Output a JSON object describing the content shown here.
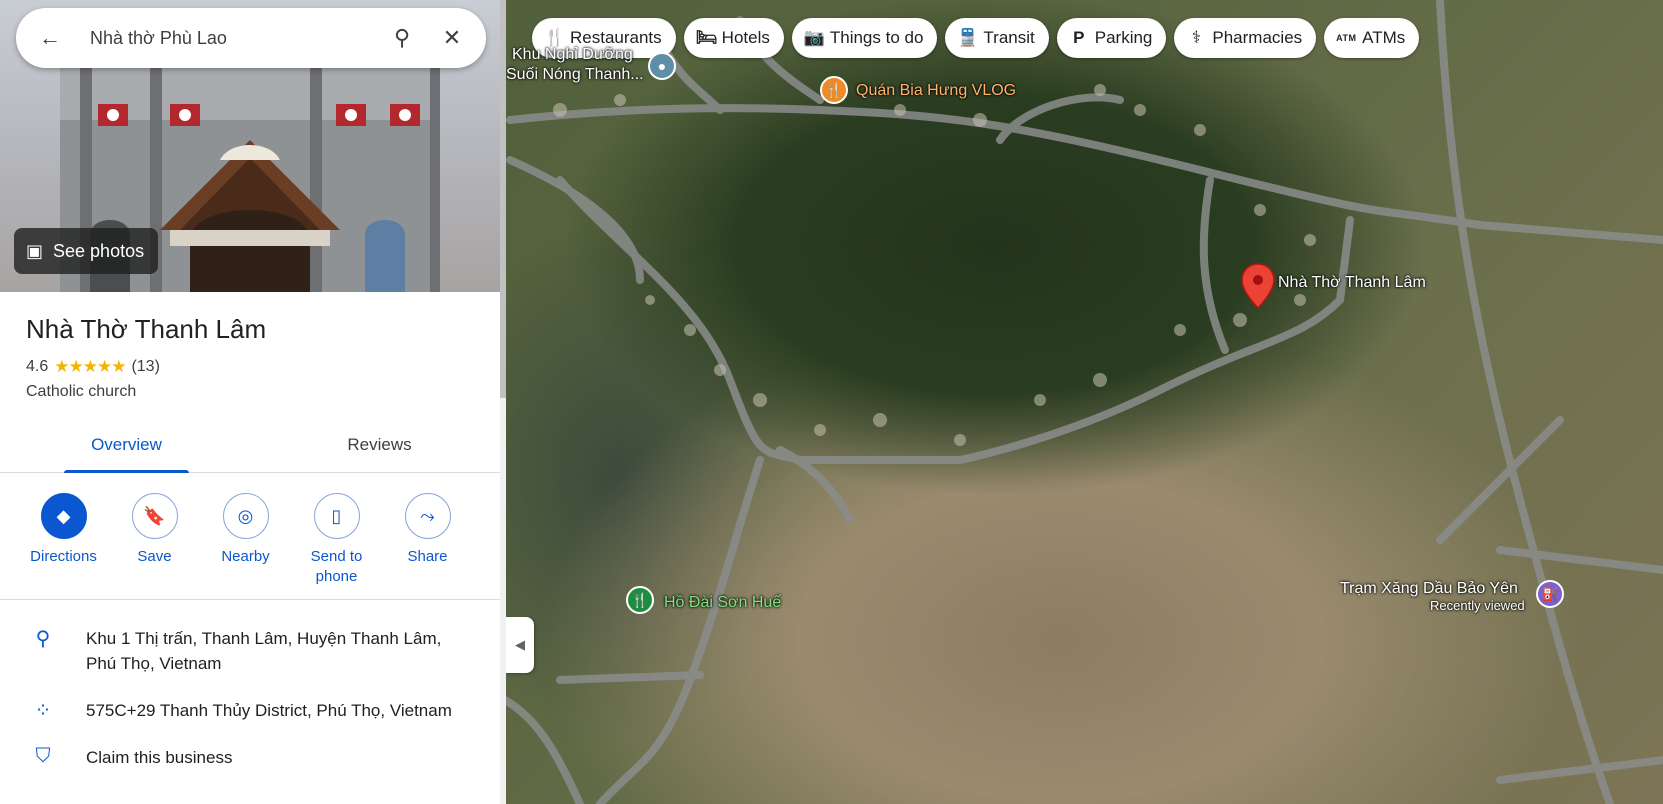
{
  "search": {
    "value": "Nhà thờ Phù Lao"
  },
  "hero": {
    "see_photos": "See photos"
  },
  "place": {
    "title": "Nhà Thờ Thanh Lâm",
    "rating": "4.6",
    "stars": "★★★★★",
    "rating_fraction": 0.92,
    "review_count": "(13)",
    "category": "Catholic church"
  },
  "tabs": [
    {
      "label": "Overview",
      "active": true
    },
    {
      "label": "Reviews",
      "active": false
    }
  ],
  "actions": [
    {
      "label": "Directions",
      "icon": "directions-icon"
    },
    {
      "label": "Save",
      "icon": "bookmark-icon"
    },
    {
      "label": "Nearby",
      "icon": "nearby-icon"
    },
    {
      "label": "Send to phone",
      "icon": "send-to-phone-icon"
    },
    {
      "label": "Share",
      "icon": "share-icon"
    }
  ],
  "info": {
    "address": "Khu 1 Thị trấn, Thanh Lâm, Huyện Thanh Lâm, Phú Thọ, Vietnam",
    "plus_code": "575C+29 Thanh Thủy District, Phú Thọ, Vietnam",
    "claim": "Claim this business"
  },
  "chips": [
    {
      "label": "Restaurants",
      "icon": "fork-knife-icon"
    },
    {
      "label": "Hotels",
      "icon": "bed-icon"
    },
    {
      "label": "Things to do",
      "icon": "camera-icon"
    },
    {
      "label": "Transit",
      "icon": "train-icon"
    },
    {
      "label": "Parking",
      "icon": "parking-icon"
    },
    {
      "label": "Pharmacies",
      "icon": "pharmacy-icon"
    },
    {
      "label": "ATMs",
      "icon": "atm-icon"
    }
  ],
  "map_labels": {
    "top_left_1": "Khu Nghỉ Dưỡng",
    "top_left_2": "Suối Nóng Thanh...",
    "restaurant": "Quán Bia Hưng VLOG",
    "church": "Nhà Thờ Thanh Lâm",
    "lake": "Hồ Đài Sơn Huế",
    "gas_station": "Trạm Xăng Dầu Bảo Yên",
    "recently_viewed": "Recently viewed"
  },
  "colors": {
    "accent": "#0b57d0",
    "pin_red": "#ea4335",
    "star": "#f5b400"
  }
}
